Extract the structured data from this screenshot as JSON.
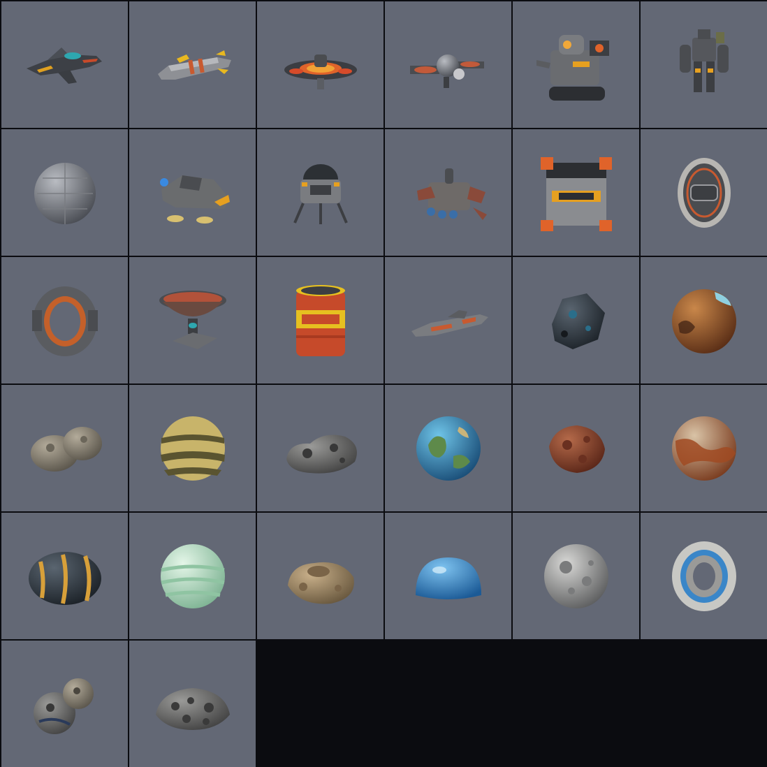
{
  "grid": {
    "columns": 6,
    "background_color": "#636875",
    "empty_color": "#0b0c10"
  },
  "assets": [
    {
      "icon": "fighter-ship-icon"
    },
    {
      "icon": "cargo-shuttle-icon"
    },
    {
      "icon": "saucer-station-icon"
    },
    {
      "icon": "satellite-drone-icon"
    },
    {
      "icon": "tracked-robot-icon"
    },
    {
      "icon": "mech-suit-icon"
    },
    {
      "icon": "sphere-station-icon"
    },
    {
      "icon": "hover-car-icon"
    },
    {
      "icon": "lander-pod-icon"
    },
    {
      "icon": "crab-ship-icon"
    },
    {
      "icon": "supply-crate-icon"
    },
    {
      "icon": "round-hatch-icon"
    },
    {
      "icon": "ring-portal-icon"
    },
    {
      "icon": "dish-pedestal-icon"
    },
    {
      "icon": "fuel-barrel-icon"
    },
    {
      "icon": "cruiser-ship-icon"
    },
    {
      "icon": "dark-asteroid-icon"
    },
    {
      "icon": "rust-planet-icon"
    },
    {
      "icon": "double-asteroid-icon"
    },
    {
      "icon": "banded-planet-icon"
    },
    {
      "icon": "cratered-rock-icon"
    },
    {
      "icon": "earth-planet-icon"
    },
    {
      "icon": "red-asteroid-icon"
    },
    {
      "icon": "mars-planet-icon"
    },
    {
      "icon": "lava-asteroid-icon"
    },
    {
      "icon": "mint-gas-planet-icon"
    },
    {
      "icon": "tan-crater-rock-icon"
    },
    {
      "icon": "blue-dome-icon"
    },
    {
      "icon": "moon-icon"
    },
    {
      "icon": "wheel-ring-icon"
    },
    {
      "icon": "asteroid-cluster-icon"
    },
    {
      "icon": "rubble-pile-icon"
    }
  ]
}
